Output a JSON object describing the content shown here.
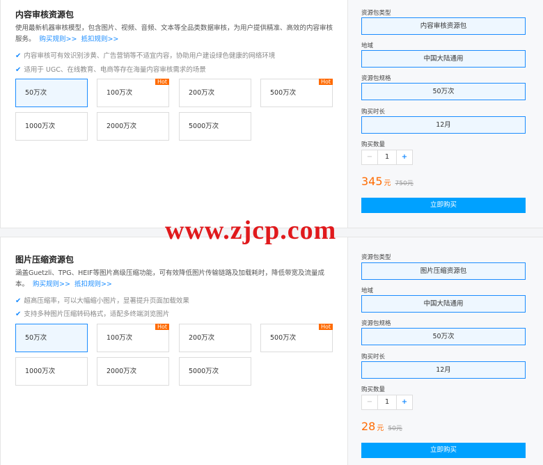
{
  "packages": [
    {
      "title": "内容审核资源包",
      "desc": "使用最新机器审核模型，包含图片、视频、音频、文本等全品类数据审核，为用户提供精准、高效的内容审核服务。",
      "link1": "购买规则>>",
      "link2": "抵扣规则>>",
      "features": [
        "内容审核可有效识别涉黄、广告营销等不适宜内容，协助用户建设绿色健康的网络环境",
        "适用于 UGC、在线教育、电商等存在海量内容审核需求的场景"
      ],
      "options": [
        {
          "label": "50万次",
          "hot": ""
        },
        {
          "label": "100万次",
          "hot": "Hot"
        },
        {
          "label": "200万次",
          "hot": ""
        },
        {
          "label": "500万次",
          "hot": "Hot"
        },
        {
          "label": "1000万次",
          "hot": ""
        },
        {
          "label": "2000万次",
          "hot": ""
        },
        {
          "label": "5000万次",
          "hot": ""
        }
      ],
      "form": {
        "type_label": "资源包类型",
        "type_value": "内容审核资源包",
        "region_label": "地域",
        "region_value": "中国大陆通用",
        "spec_label": "资源包规格",
        "spec_value": "50万次",
        "duration_label": "购买时长",
        "duration_value": "12月",
        "qty_label": "购买数量",
        "qty_minus": "−",
        "qty_value": "1",
        "qty_plus": "+",
        "price": "345",
        "unit": "元",
        "old_price": "750元",
        "buy_label": "立即购买"
      }
    },
    {
      "title": "图片压缩资源包",
      "desc": "涵盖Guetzli、TPG、HEIF等图片高级压缩功能，可有效降低图片传输链路及加载耗时，降低带宽及流量成本。",
      "link1": "购买规则>>",
      "link2": "抵扣规则>>",
      "features": [
        "超高压缩率，可以大幅缩小图片，显著提升页面加载效果",
        "支持多种图片压缩转码格式，适配多终端浏览图片"
      ],
      "options": [
        {
          "label": "50万次",
          "hot": ""
        },
        {
          "label": "100万次",
          "hot": "Hot"
        },
        {
          "label": "200万次",
          "hot": ""
        },
        {
          "label": "500万次",
          "hot": "Hot"
        },
        {
          "label": "1000万次",
          "hot": ""
        },
        {
          "label": "2000万次",
          "hot": ""
        },
        {
          "label": "5000万次",
          "hot": ""
        }
      ],
      "form": {
        "type_label": "资源包类型",
        "type_value": "图片压缩资源包",
        "region_label": "地域",
        "region_value": "中国大陆通用",
        "spec_label": "资源包规格",
        "spec_value": "50万次",
        "duration_label": "购买时长",
        "duration_value": "12月",
        "qty_label": "购买数量",
        "qty_minus": "−",
        "qty_value": "1",
        "qty_plus": "+",
        "price": "28",
        "unit": "元",
        "old_price": "50元",
        "buy_label": "立即购买"
      }
    }
  ],
  "watermark": "www.zjcp.com",
  "icons": {
    "check": "check-icon"
  },
  "colors": {
    "accent": "#1a8cff",
    "price": "#ff6a00",
    "hot": "#ff6a00",
    "buy": "#00a1ff",
    "watermark": "#e0191c"
  }
}
